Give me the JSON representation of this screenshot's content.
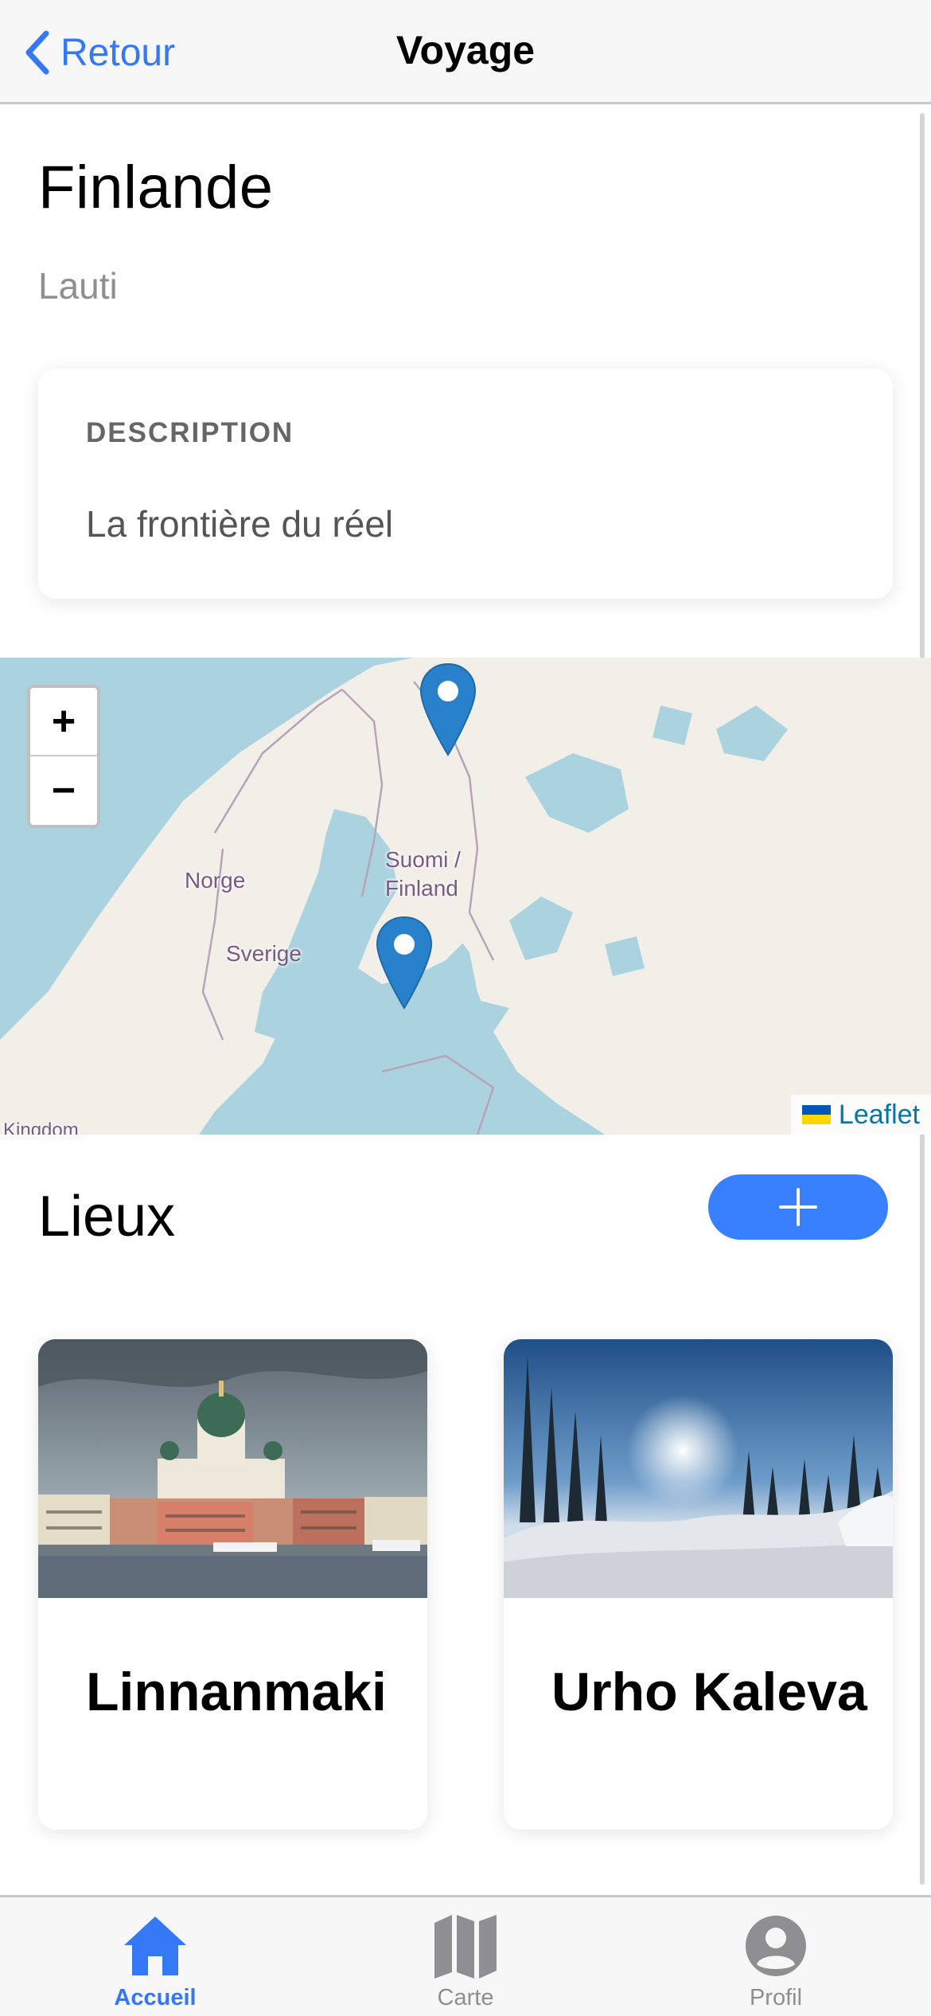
{
  "header": {
    "back_label": "Retour",
    "title": "Voyage"
  },
  "trip": {
    "title": "Finlande",
    "subtitle": "Lauti"
  },
  "description": {
    "heading": "DESCRIPTION",
    "text": "La frontière du réel"
  },
  "map": {
    "zoom_in": "+",
    "zoom_out": "−",
    "labels": {
      "norway": "Norge",
      "sweden": "Sverige",
      "finland": "Suomi /\nFinland",
      "kingdom": "Kingdom"
    },
    "attribution": "Leaflet",
    "marker_color": "#2a81cb",
    "marker_count": 2
  },
  "places": {
    "title": "Lieux",
    "add_icon": "plus-icon",
    "items": [
      {
        "name": "Linnanmaki",
        "image": "helsinki-cathedral-photo"
      },
      {
        "name": "Urho Kaleva",
        "image": "snowy-forest-photo"
      }
    ]
  },
  "tabbar": {
    "tabs": [
      {
        "label": "Accueil",
        "icon": "home-icon",
        "active": true
      },
      {
        "label": "Carte",
        "icon": "map-icon",
        "active": false
      },
      {
        "label": "Profil",
        "icon": "person-icon",
        "active": false
      }
    ]
  },
  "colors": {
    "accent": "#3478f6",
    "add_button": "#3880ff",
    "water": "#aad3df",
    "land": "#f2efe9"
  }
}
